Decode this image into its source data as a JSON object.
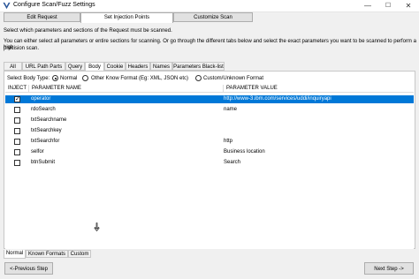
{
  "window": {
    "title": "Configure Scan/Fuzz Settings",
    "minimize": "—",
    "maximize": "☐",
    "close": "✕",
    "accent": "#0078d7"
  },
  "main_tabs": [
    {
      "label": "Edit Request",
      "active": false
    },
    {
      "label": "Set Injection Points",
      "active": true
    },
    {
      "label": "Customize Scan",
      "active": false
    }
  ],
  "description": {
    "line1": "Select which parameters and sections of the Request must be scanned.",
    "line2": "You can either select all parameters or entire sections for scanning. Or go through the different tabs below and select the exact parameters you want to be scanned to perform a high",
    "line3": "precision scan."
  },
  "sub_tabs": [
    {
      "label": "All",
      "active": false
    },
    {
      "label": "URL Path Parts",
      "active": false
    },
    {
      "label": "Query",
      "active": false
    },
    {
      "label": "Body",
      "active": true
    },
    {
      "label": "Cookie",
      "active": false
    },
    {
      "label": "Headers",
      "active": false
    },
    {
      "label": "Names",
      "active": false
    },
    {
      "label": "Parameters Black-list",
      "active": false
    }
  ],
  "body_type": {
    "label": "Select Body Type:",
    "options": [
      {
        "label": "Normal",
        "checked": true
      },
      {
        "label": "Other Know Format (Eg: XML, JSON etc)",
        "checked": false
      },
      {
        "label": "Custom/Unknown Format",
        "checked": false
      }
    ]
  },
  "grid": {
    "headers": {
      "inject": "INJECT",
      "name": "PARAMETER NAME",
      "value": "PARAMETER VALUE"
    },
    "rows": [
      {
        "name": "operator",
        "value": "http://www-3.ibm.com/services/uddi/inquiryapi",
        "checked": true,
        "selected": true
      },
      {
        "name": "rdoSearch",
        "value": "name",
        "checked": false,
        "selected": false
      },
      {
        "name": "txtSearchname",
        "value": "",
        "checked": false,
        "selected": false
      },
      {
        "name": "txtSearchkey",
        "value": "",
        "checked": false,
        "selected": false
      },
      {
        "name": "txtSearchfor",
        "value": "http",
        "checked": false,
        "selected": false
      },
      {
        "name": "selfor",
        "value": "Business location",
        "checked": false,
        "selected": false
      },
      {
        "name": "btnSubmit",
        "value": "Search",
        "checked": false,
        "selected": false
      }
    ]
  },
  "bottom_tabs": [
    {
      "label": "Normal",
      "active": true
    },
    {
      "label": "Known Formats",
      "active": false
    },
    {
      "label": "Custom",
      "active": false
    }
  ],
  "nav": {
    "prev": "<-Previous Step",
    "next": "Next Step ->"
  }
}
